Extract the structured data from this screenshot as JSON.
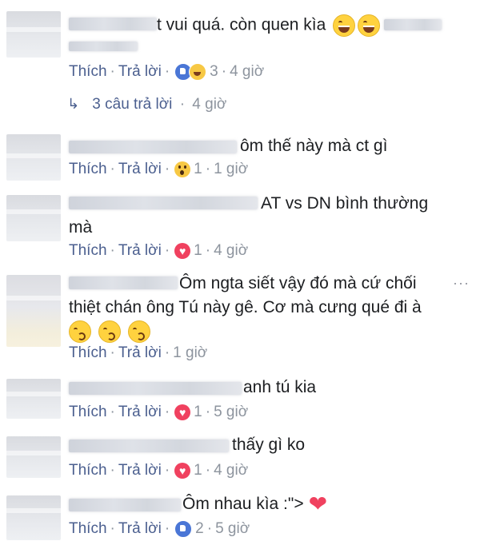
{
  "actions": {
    "like": "Thích",
    "reply": "Trả lời",
    "separator": "·"
  },
  "comments": [
    {
      "text": "t vui quá. còn quen kìa",
      "reaction_count": "3",
      "time": "4 giờ",
      "replies": "3 câu trả lời",
      "replies_time": "4 giờ"
    },
    {
      "text": "ôm thế này mà ct gì",
      "reaction_count": "1",
      "time": "1 giờ"
    },
    {
      "text_line1": "AT vs DN bình thường",
      "text_line2": "mà",
      "reaction_count": "1",
      "time": "4 giờ"
    },
    {
      "text_line1": "Ôm ngta siết vậy đó mà cứ chối",
      "text_line2": "thiệt chán ông Tú này gê. Cơ mà cưng qué đi à",
      "time": "1 giờ",
      "more": "···"
    },
    {
      "text": "anh tú kia",
      "reaction_count": "1",
      "time": "5 giờ"
    },
    {
      "text": "thấy gì ko",
      "reaction_count": "1",
      "time": "4 giờ"
    },
    {
      "text": "Ôm nhau kìa :\">",
      "reaction_count": "2",
      "time": "5 giờ"
    }
  ],
  "colors": {
    "link": "#4b5f8f",
    "meta": "#8d949e",
    "like_reaction": "#4a76d6",
    "love_reaction": "#f0415f",
    "emoji_yellow": "#ffd23f"
  },
  "icons": [
    "reply-arrow-icon",
    "like-reaction-icon",
    "haha-reaction-icon",
    "wow-reaction-icon",
    "love-reaction-icon",
    "grin-emoji-icon",
    "kiss-emoji-icon",
    "heart-emoji-icon",
    "more-options-icon"
  ]
}
